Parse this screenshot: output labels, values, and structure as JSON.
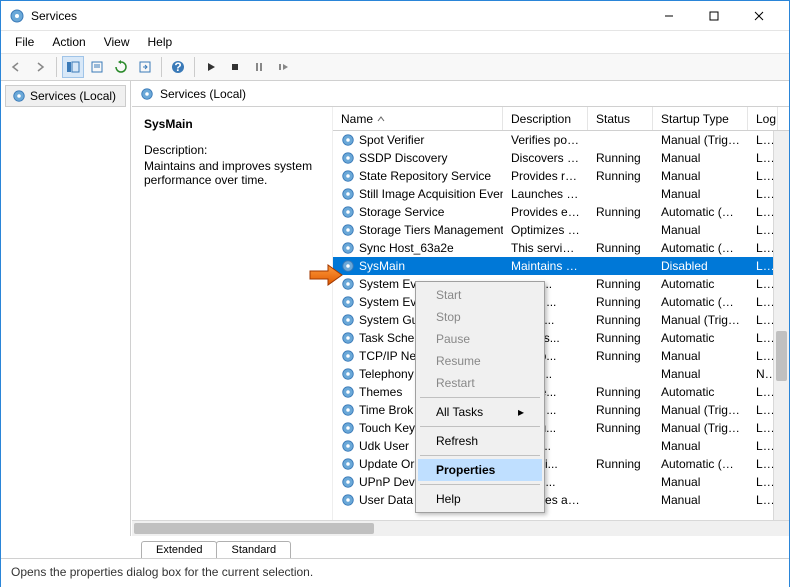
{
  "window": {
    "title": "Services"
  },
  "menubar": [
    "File",
    "Action",
    "View",
    "Help"
  ],
  "tree": {
    "root": "Services (Local)"
  },
  "content_header": "Services (Local)",
  "detail": {
    "selected_name": "SysMain",
    "description_label": "Description:",
    "description_text": "Maintains and improves system performance over time."
  },
  "columns": {
    "name": "Name",
    "description": "Description",
    "status": "Status",
    "startup": "Startup Type",
    "logon": "Log"
  },
  "rows": [
    {
      "name": "Spot Verifier",
      "desc": "Verifies pote...",
      "status": "",
      "startup": "Manual (Trigg...",
      "logon": "Loc"
    },
    {
      "name": "SSDP Discovery",
      "desc": "Discovers ne...",
      "status": "Running",
      "startup": "Manual",
      "logon": "Loc"
    },
    {
      "name": "State Repository Service",
      "desc": "Provides req...",
      "status": "Running",
      "startup": "Manual",
      "logon": "Loc"
    },
    {
      "name": "Still Image Acquisition Events",
      "desc": "Launches ap...",
      "status": "",
      "startup": "Manual",
      "logon": "Loc"
    },
    {
      "name": "Storage Service",
      "desc": "Provides ena...",
      "status": "Running",
      "startup": "Automatic (De...",
      "logon": "Loc"
    },
    {
      "name": "Storage Tiers Management",
      "desc": "Optimizes th...",
      "status": "",
      "startup": "Manual",
      "logon": "Loc"
    },
    {
      "name": "Sync Host_63a2e",
      "desc": "This service ...",
      "status": "Running",
      "startup": "Automatic (De...",
      "logon": "Loc"
    },
    {
      "name": "SysMain",
      "desc": "Maintains a...",
      "status": "",
      "startup": "Disabled",
      "logon": "Loc",
      "selected": true
    },
    {
      "name": "System Ev",
      "desc": "ors sy...",
      "status": "Running",
      "startup": "Automatic",
      "logon": "Loc"
    },
    {
      "name": "System Ev",
      "desc": "inates ...",
      "status": "Running",
      "startup": "Automatic (Trig...",
      "logon": "Loc"
    },
    {
      "name": "System Gu",
      "desc": "ors an...",
      "status": "Running",
      "startup": "Manual (Trigg...",
      "logon": "Loc"
    },
    {
      "name": "Task Sche",
      "desc": "es a us...",
      "status": "Running",
      "startup": "Automatic",
      "logon": "Loc"
    },
    {
      "name": "TCP/IP Net",
      "desc": "es sup...",
      "status": "Running",
      "startup": "Manual",
      "logon": "Loc"
    },
    {
      "name": "Telephony",
      "desc": "es Tel...",
      "status": "",
      "startup": "Manual",
      "logon": "Ne"
    },
    {
      "name": "Themes",
      "desc": "es use...",
      "status": "Running",
      "startup": "Automatic",
      "logon": "Loc"
    },
    {
      "name": "Time Brok",
      "desc": "inates ...",
      "status": "Running",
      "startup": "Manual (Trigg...",
      "logon": "Loc"
    },
    {
      "name": "Touch Key",
      "desc": "es Tou...",
      "status": "Running",
      "startup": "Manual (Trigg...",
      "logon": "Loc"
    },
    {
      "name": "Udk User",
      "desc": "ompo...",
      "status": "",
      "startup": "Manual",
      "logon": "Loc"
    },
    {
      "name": "Update Or",
      "desc": "ges Wi...",
      "status": "Running",
      "startup": "Automatic (De...",
      "logon": "Loc"
    },
    {
      "name": "UPnP Devi",
      "desc": "UPnP ...",
      "status": "",
      "startup": "Manual",
      "logon": "Loc"
    },
    {
      "name": "User Data Access_63a2e",
      "desc": "Provides ap...",
      "status": "",
      "startup": "Manual",
      "logon": "Loc"
    }
  ],
  "context_menu": {
    "start": "Start",
    "stop": "Stop",
    "pause": "Pause",
    "resume": "Resume",
    "restart": "Restart",
    "all_tasks": "All Tasks",
    "refresh": "Refresh",
    "properties": "Properties",
    "help": "Help"
  },
  "tabs": {
    "extended": "Extended",
    "standard": "Standard"
  },
  "statusbar": "Opens the properties dialog box for the current selection."
}
